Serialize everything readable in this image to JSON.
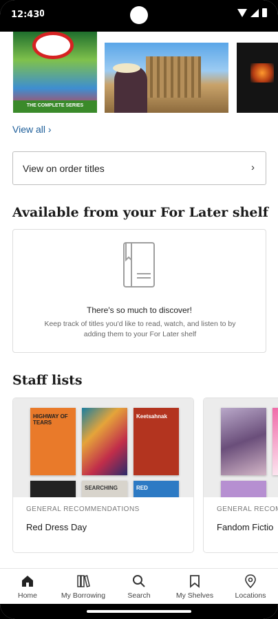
{
  "status_bar": {
    "time": "12:43"
  },
  "carousel": {
    "items": [
      {
        "icon": "ghostbusters-cover",
        "caption": "THE COMPLETE SERIES"
      },
      {
        "icon": "travel-ruins-cover"
      },
      {
        "icon": "dark-fire-cover"
      }
    ]
  },
  "view_all_label": "View all ›",
  "order_button": {
    "label": "View on order titles",
    "chevron": "›"
  },
  "for_later": {
    "title": "Available from your For Later shelf",
    "empty_heading": "There's so much to discover!",
    "empty_desc": "Keep track of titles you'd like to read, watch, and listen to by adding them to your For Later shelf"
  },
  "staff_lists": {
    "title": "Staff lists",
    "cards": [
      {
        "category": "GENERAL RECOMMENDATIONS",
        "name": "Red Dress Day",
        "covers": [
          "HIGHWAY OF TEARS",
          "",
          "Keetsahnak",
          "",
          "SEARCHING",
          "RED"
        ]
      },
      {
        "category": "GENERAL RECOMM",
        "name": "Fandom Fictio",
        "covers": [
          "",
          ""
        ]
      }
    ]
  },
  "bottom_nav": [
    {
      "label": "Home",
      "icon": "home-icon"
    },
    {
      "label": "My Borrowing",
      "icon": "books-icon"
    },
    {
      "label": "Search",
      "icon": "search-icon"
    },
    {
      "label": "My Shelves",
      "icon": "bookmark-icon"
    },
    {
      "label": "Locations",
      "icon": "location-pin-icon"
    }
  ],
  "colors": {
    "link": "#1c5d99",
    "text": "#1a1a1a"
  }
}
